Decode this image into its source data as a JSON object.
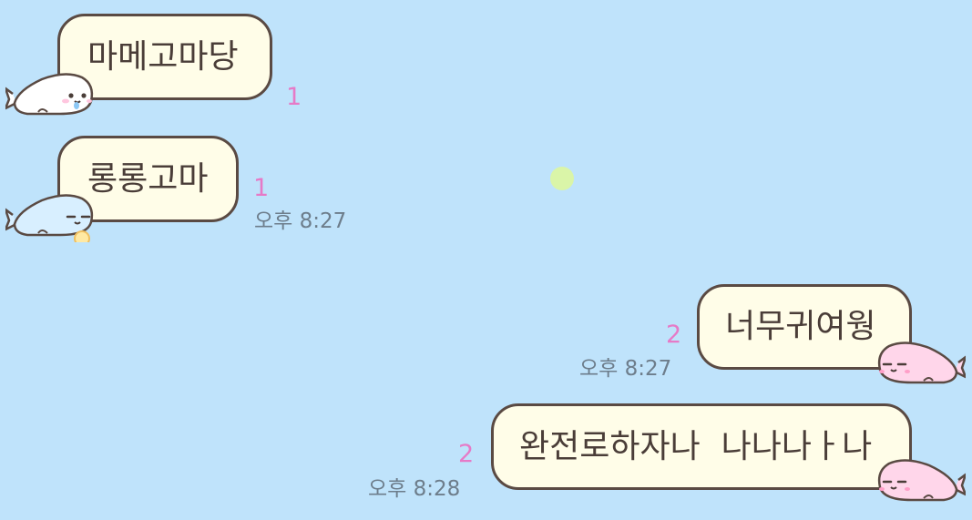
{
  "conversation": {
    "messages": [
      {
        "side": "received",
        "text": "마메고마당",
        "unread": "1",
        "time": ""
      },
      {
        "side": "received",
        "text": "롱롱고마",
        "unread": "1",
        "time": "오후 8:27"
      },
      {
        "side": "sent",
        "text": "너무귀여웡",
        "unread": "2",
        "time": "오후 8:27"
      },
      {
        "side": "sent",
        "text": "완전로하자나  나나나ㅏ나",
        "unread": "2",
        "time": "오후 8:28"
      }
    ]
  },
  "colors": {
    "background": "#bfe3fb",
    "bubble_fill": "#fffde8",
    "bubble_border": "#5a4a43",
    "unread_count": "#e67ac7",
    "timestamp": "#6d7d8b",
    "seal_white": "#ffffff",
    "seal_blue": "#d8efff",
    "seal_pink": "#ffd6ea"
  },
  "icons": {
    "msg0_seal": "white-seal-sticker",
    "msg1_seal": "blue-seal-sticker",
    "msg2_seal": "pink-seal-sticker",
    "msg3_seal": "pink-seal-sticker",
    "decoration": "green-dot"
  }
}
